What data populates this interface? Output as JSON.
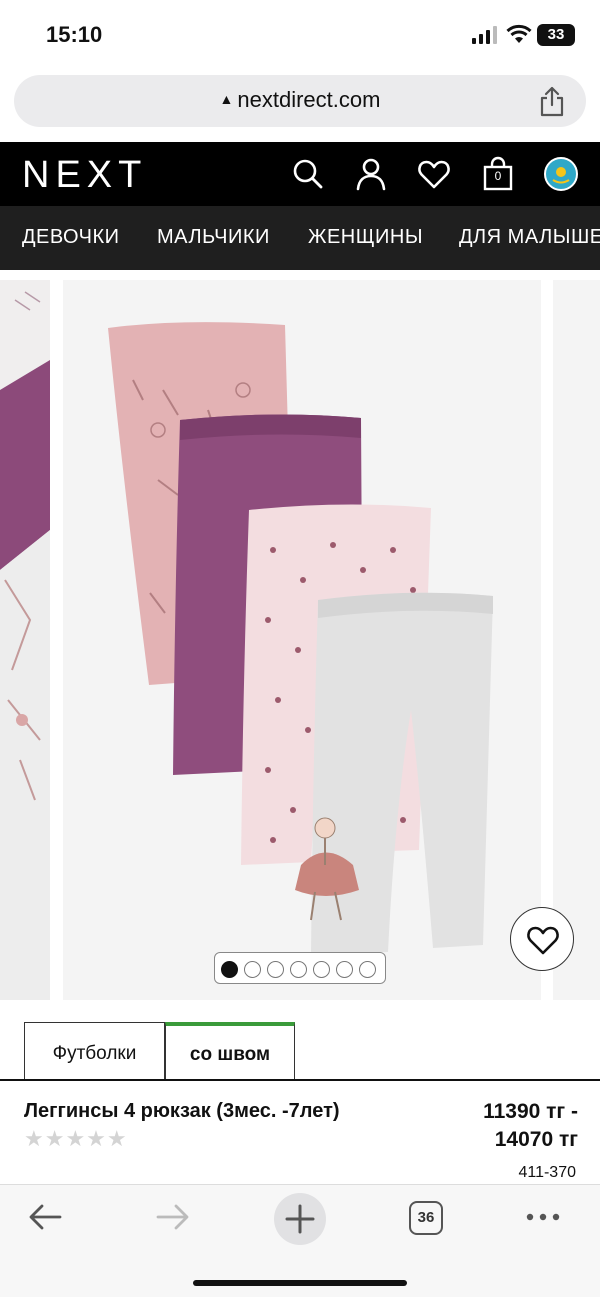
{
  "status": {
    "time": "15:10",
    "battery": "33"
  },
  "browser": {
    "url": "nextdirect.com",
    "tabs_count": "36"
  },
  "header": {
    "logo": "NEXT",
    "bag_count": "0"
  },
  "nav": {
    "items": [
      "ДЕВОЧКИ",
      "МАЛЬЧИКИ",
      "ЖЕНЩИНЫ",
      "ДЛЯ МАЛЫШЕЙ"
    ]
  },
  "carousel": {
    "slide_count": 7,
    "active_index": 0
  },
  "tabs": {
    "tab1": "Футболки",
    "tab2": "со швом"
  },
  "product": {
    "name": "Леггинсы 4 рюкзак (3мес. -7лет)",
    "price_line1": "11390 тг -",
    "price_line2": "14070 тг",
    "code": "411-370",
    "rating": 0,
    "stars": "★★★★★"
  },
  "colors": {
    "header_bg": "#000000",
    "nav_bg": "#1f1f1f",
    "active_tab_accent": "#3a9b3a"
  }
}
